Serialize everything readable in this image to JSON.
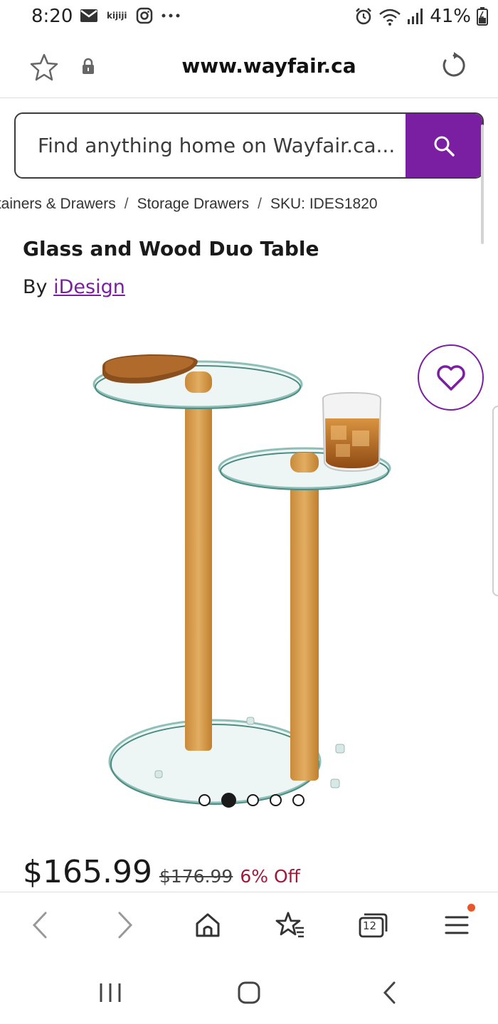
{
  "status_bar": {
    "time": "8:20",
    "kijiji_label": "kijiji",
    "battery": "41%",
    "icons": [
      "mail-icon",
      "kijiji-icon",
      "instagram-icon",
      "more-dots-icon",
      "alarm-icon",
      "wifi-icon",
      "signal-icon",
      "battery-icon"
    ]
  },
  "browser": {
    "url": "www.wayfair.ca",
    "tab_count": "12"
  },
  "search": {
    "placeholder": "Find anything home on Wayfair.ca..."
  },
  "breadcrumb": {
    "items": [
      "ıtainers & Drawers",
      "Storage Drawers",
      "SKU: IDES1820"
    ],
    "separator": "/"
  },
  "product": {
    "title": "Glass and Wood Duo Table",
    "brand_prefix": "By",
    "brand": "iDesign",
    "image_dots": 5,
    "active_dot": 1
  },
  "price": {
    "current": "$165.99",
    "original": "$176.99",
    "discount": "6% Off"
  },
  "colors": {
    "accent": "#7b1fa2",
    "discount": "#a0183a",
    "notification": "#e8562a"
  }
}
